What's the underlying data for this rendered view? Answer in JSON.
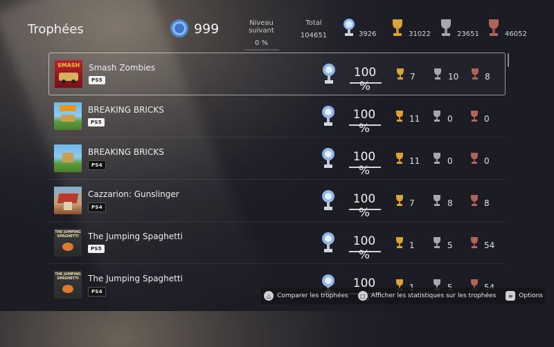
{
  "header": {
    "title": "Trophées",
    "level": "999",
    "next_level_label": "Niveau suivant",
    "next_level_value": "0 %",
    "total_label": "Total",
    "total_value": "104651",
    "platinum": "3926",
    "gold": "31022",
    "silver": "23651",
    "bronze": "46052"
  },
  "games": [
    {
      "name": "Smash Zombies",
      "platform": "PS5",
      "progress": "100 %",
      "gold": "7",
      "silver": "10",
      "bronze": "8",
      "thumb_text": "SMASH",
      "selected": true
    },
    {
      "name": "BREAKING BRICKS",
      "platform": "PS5",
      "progress": "100 %",
      "gold": "11",
      "silver": "0",
      "bronze": "0",
      "thumb_text": ""
    },
    {
      "name": "BREAKING BRICKS",
      "platform": "PS4",
      "progress": "100 %",
      "gold": "11",
      "silver": "0",
      "bronze": "0",
      "thumb_text": ""
    },
    {
      "name": "Cazzarion: Gunslinger",
      "platform": "PS4",
      "progress": "100 %",
      "gold": "7",
      "silver": "8",
      "bronze": "8",
      "thumb_text": ""
    },
    {
      "name": "The Jumping Spaghetti",
      "platform": "PS5",
      "progress": "100 %",
      "gold": "1",
      "silver": "5",
      "bronze": "54",
      "thumb_text": "THE JUMPING SPAGHETTI"
    },
    {
      "name": "The Jumping Spaghetti",
      "platform": "PS4",
      "progress": "100 %",
      "gold": "1",
      "silver": "5",
      "bronze": "54",
      "thumb_text": "THE JUMPING SPAGHETTI"
    }
  ],
  "footer": {
    "compare": "Comparer les trophées",
    "stats": "Afficher les statistiques sur les trophées",
    "options": "Options"
  },
  "colors": {
    "gold": "#d9a33a",
    "silver": "#a6a8ae",
    "bronze": "#b0635a",
    "platinum": "#8fb4e6"
  }
}
